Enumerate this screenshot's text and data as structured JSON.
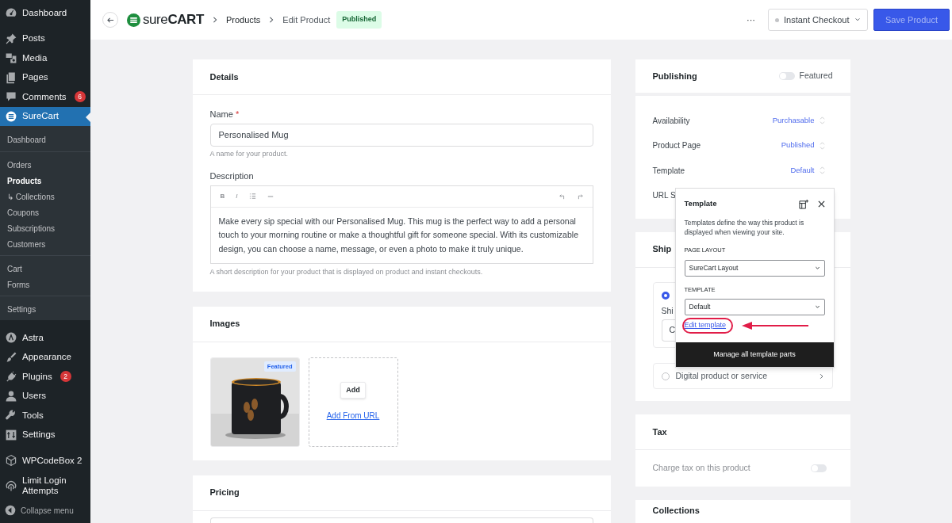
{
  "sidebar": {
    "menu_groups": [
      [
        {
          "label": "Dashboard",
          "selected": false
        }
      ],
      [
        {
          "label": "Posts",
          "selected": false
        },
        {
          "label": "Media",
          "selected": false
        },
        {
          "label": "Pages",
          "selected": false
        },
        {
          "label": "Comments",
          "selected": false,
          "badge": "6"
        },
        {
          "label": "SureCart",
          "selected": true,
          "submenu": [
            [
              {
                "label": "Dashboard",
                "selected": false
              }
            ],
            [
              {
                "label": "Orders",
                "selected": false
              },
              {
                "label": "Products",
                "selected": true
              },
              {
                "label": "↳ Collections",
                "selected": false
              },
              {
                "label": "Coupons",
                "selected": false
              },
              {
                "label": "Subscriptions",
                "selected": false
              },
              {
                "label": "Customers",
                "selected": false
              }
            ],
            [
              {
                "label": "Cart",
                "selected": false
              },
              {
                "label": "Forms",
                "selected": false
              }
            ],
            [
              {
                "label": "Settings",
                "selected": false
              }
            ]
          ]
        }
      ],
      [
        {
          "label": "Astra",
          "selected": false
        },
        {
          "label": "Appearance",
          "selected": false
        },
        {
          "label": "Plugins",
          "selected": false,
          "badge": "2"
        },
        {
          "label": "Users",
          "selected": false
        },
        {
          "label": "Tools",
          "selected": false
        },
        {
          "label": "Settings",
          "selected": false
        }
      ],
      [
        {
          "label": "WPCodeBox 2",
          "selected": false
        },
        {
          "label": "Limit Login Attempts",
          "selected": false
        }
      ]
    ],
    "collapse": "Collapse menu"
  },
  "header": {
    "logo": "sure**CART**",
    "breadcrumbs": [
      "Products",
      "Edit Product"
    ],
    "status": "Published",
    "more": "···",
    "checkout": "Instant Checkout",
    "save": "Save Product"
  },
  "details": {
    "title": "Details",
    "name_label": "Name",
    "required": "*",
    "name_value": "Personalised Mug",
    "name_hint": "A name for your product.",
    "description_label": "Description",
    "toolbar": [
      {
        "kind": "bold",
        "glyph": "B"
      },
      {
        "kind": "italic",
        "glyph": "I"
      }
    ],
    "description": "Make every sip special with our Personalised Mug. This mug is the perfect way to add a personal touch to your morning routine or make a thoughtful gift for someone special. With its customizable design, you can choose a name, message, or even a photo to make it truly unique.",
    "description_hint": "A short description for your product that is displayed on product and instant checkouts."
  },
  "images": {
    "title": "Images",
    "items": [
      {
        "kind": "picture",
        "badge": "Featured"
      }
    ],
    "add": "Add",
    "add_url": "Add From URL"
  },
  "pricing": {
    "title": "Pricing"
  },
  "publishing": {
    "title": "Publishing",
    "featured": {
      "label": "Featured",
      "on": false
    },
    "rows": [
      {
        "label": "Availability",
        "value": "Purchasable"
      },
      {
        "label": "Product Page",
        "value": "Published"
      },
      {
        "label": "Template",
        "value": "Default"
      },
      {
        "label": "URL S"
      }
    ]
  },
  "shipping": {
    "title": "Ship",
    "options": [
      {
        "selected": true,
        "field_label": "Shi",
        "field_value": "C"
      },
      {
        "selected": false,
        "label": "Digital product or service"
      }
    ]
  },
  "tax": {
    "title": "Tax",
    "charge": {
      "label": "Charge tax on this product",
      "on": false
    }
  },
  "collections": {
    "title": "Collections"
  },
  "template_popover": {
    "title": "Template",
    "description": "Templates define the way this product is displayed when viewing your site.",
    "page_layout_label": "PAGE LAYOUT",
    "page_layout": "SureCart Layout",
    "template_label": "TEMPLATE",
    "template": "Default",
    "edit_link": "Edit template",
    "manage": "Manage all template parts"
  }
}
